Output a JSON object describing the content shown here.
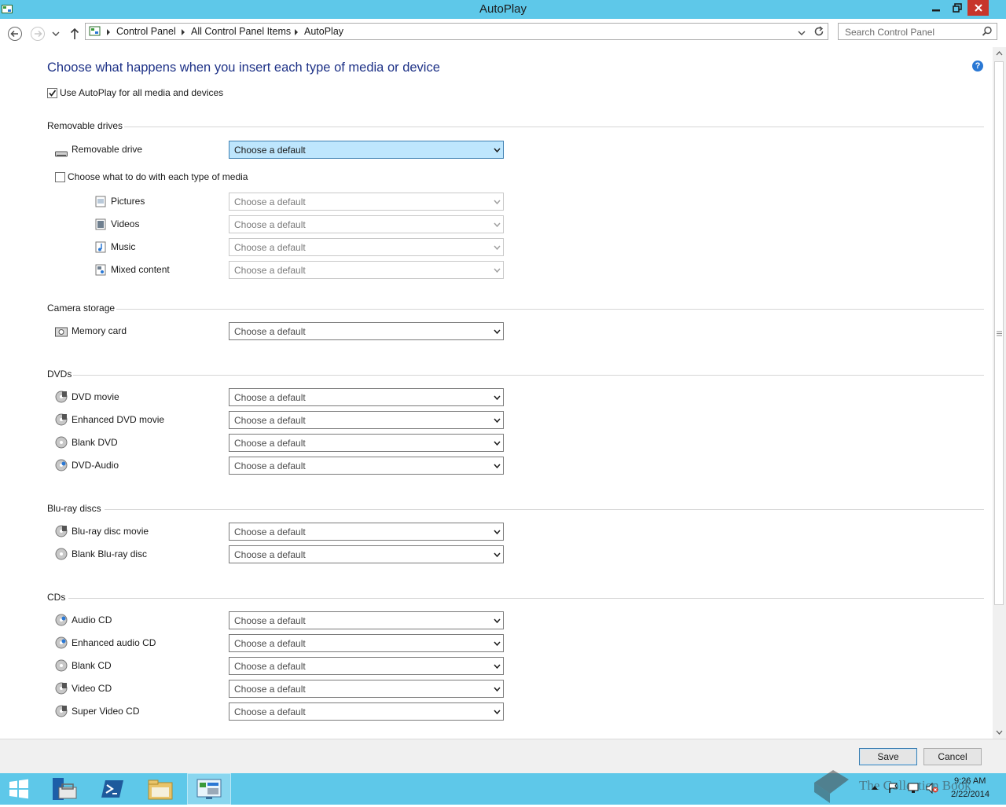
{
  "window": {
    "title": "AutoPlay"
  },
  "address": {
    "crumbs": [
      "Control Panel",
      "All Control Panel Items",
      "AutoPlay"
    ],
    "search_placeholder": "Search Control Panel"
  },
  "main": {
    "heading": "Choose what happens when you insert each type of media or device",
    "use_autoplay": {
      "label": "Use AutoPlay for all media and devices",
      "checked": true
    },
    "removable": {
      "title": "Removable drives",
      "drive": {
        "label": "Removable drive",
        "value": "Choose a default"
      },
      "per_media": {
        "label": "Choose what to do with each type of media",
        "checked": false
      },
      "media": [
        {
          "label": "Pictures",
          "value": "Choose a default",
          "icon": "pictures-icon"
        },
        {
          "label": "Videos",
          "value": "Choose a default",
          "icon": "videos-icon"
        },
        {
          "label": "Music",
          "value": "Choose a default",
          "icon": "music-icon"
        },
        {
          "label": "Mixed content",
          "value": "Choose a default",
          "icon": "mixed-content-icon"
        }
      ]
    },
    "camera": {
      "title": "Camera storage",
      "items": [
        {
          "label": "Memory card",
          "value": "Choose a default",
          "icon": "memory-card-icon"
        }
      ]
    },
    "dvds": {
      "title": "DVDs",
      "items": [
        {
          "label": "DVD movie",
          "value": "Choose a default",
          "icon": "dvd-movie-icon"
        },
        {
          "label": "Enhanced DVD movie",
          "value": "Choose a default",
          "icon": "enhanced-dvd-icon"
        },
        {
          "label": "Blank DVD",
          "value": "Choose a default",
          "icon": "blank-dvd-icon"
        },
        {
          "label": "DVD-Audio",
          "value": "Choose a default",
          "icon": "dvd-audio-icon"
        }
      ]
    },
    "bluray": {
      "title": "Blu-ray discs",
      "items": [
        {
          "label": "Blu-ray disc movie",
          "value": "Choose a default",
          "icon": "bluray-movie-icon"
        },
        {
          "label": "Blank Blu-ray disc",
          "value": "Choose a default",
          "icon": "blank-bluray-icon"
        }
      ]
    },
    "cds": {
      "title": "CDs",
      "items": [
        {
          "label": "Audio CD",
          "value": "Choose a default",
          "icon": "audio-cd-icon"
        },
        {
          "label": "Enhanced audio CD",
          "value": "Choose a default",
          "icon": "enhanced-audio-cd-icon"
        },
        {
          "label": "Blank CD",
          "value": "Choose a default",
          "icon": "blank-cd-icon"
        },
        {
          "label": "Video CD",
          "value": "Choose a default",
          "icon": "video-cd-icon"
        },
        {
          "label": "Super Video CD",
          "value": "Choose a default",
          "icon": "super-video-cd-icon"
        }
      ]
    }
  },
  "footer": {
    "save_label": "Save",
    "cancel_label": "Cancel"
  },
  "taskbar": {
    "time": "9:26 AM",
    "date": "2/22/2014",
    "watermark": "The Collection Book"
  },
  "colors": {
    "titlebar": "#5ec8e9",
    "heading": "#1e3287",
    "close": "#c7362b",
    "selected_combo": "#bee6fd"
  }
}
